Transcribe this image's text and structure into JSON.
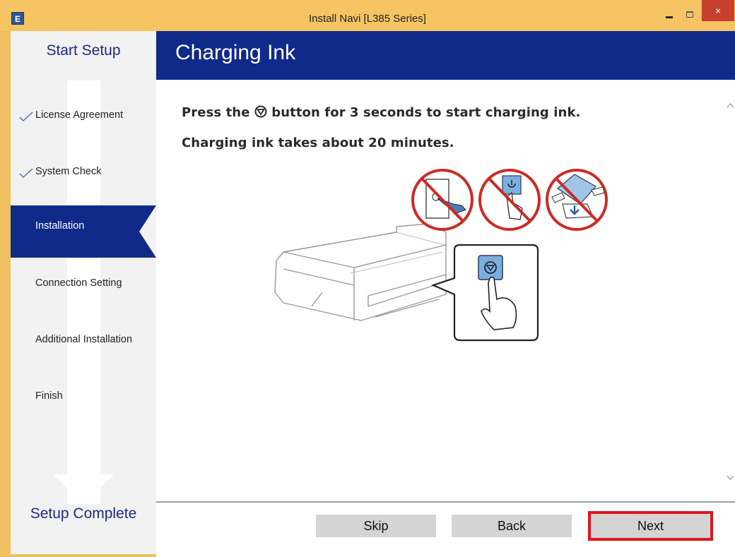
{
  "window": {
    "app_icon_letter": "E",
    "title": "Install Navi [L385 Series]",
    "close_glyph": "×"
  },
  "sidebar": {
    "start_label": "Start Setup",
    "end_label": "Setup Complete",
    "steps": [
      {
        "label": "License Agreement",
        "status": "done"
      },
      {
        "label": "System Check",
        "status": "done"
      },
      {
        "label": "Installation",
        "status": "active"
      },
      {
        "label": "Connection Setting",
        "status": "pending"
      },
      {
        "label": "Additional Installation",
        "status": "pending"
      },
      {
        "label": "Finish",
        "status": "pending"
      }
    ]
  },
  "main": {
    "title": "Charging Ink",
    "instruction1_before": "Press the",
    "instruction1_after": "button for 3 seconds to start charging ink.",
    "instruction2": "Charging ink takes about 20 minutes."
  },
  "buttons": {
    "skip": "Skip",
    "back": "Back",
    "next": "Next"
  },
  "colors": {
    "title_bar": "#f6c463",
    "brand_blue": "#102a8a",
    "highlight_red": "#e0161e",
    "prohibit_red": "#cc2b24"
  },
  "icons": [
    "ink-charge-stop-icon",
    "unplug-prohibited-icon",
    "power-button-prohibited-icon",
    "open-scanner-prohibited-icon"
  ]
}
